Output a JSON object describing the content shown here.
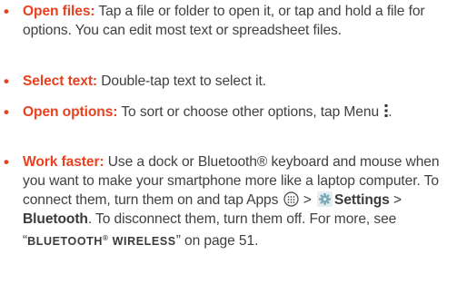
{
  "bullet_char": "•",
  "items": [
    {
      "lead": "Open files:",
      "text": " Tap a file or folder to open it, or tap and hold a file for options. You can edit most text or spreadsheet files."
    },
    {
      "lead": "Select text:",
      "text": " Double-tap text to select it."
    },
    {
      "lead": "Open options:",
      "text": " To sort or choose other options, tap Menu "
    },
    {
      "lead": "Work faster:",
      "text_a": " Use a dock or Bluetooth® keyboard and mouse when you want to make your smartphone more like a laptop computer. To connect them, turn them on and tap Apps ",
      "sep1": " > ",
      "settings_label": "Settings",
      "sep2": " > ",
      "bluetooth_label": "Bluetooth",
      "text_b": ". To disconnect them, turn them off. For more, see “",
      "xref_main": "BLUETOOTH",
      "xref_sup": "®",
      "xref_tail": " WIRELESS",
      "text_c": "” on page 51."
    }
  ],
  "icons": {
    "menu": "menu-icon",
    "apps": "apps-icon",
    "settings": "settings-gear-icon"
  },
  "colors": {
    "accent": "#e8411f",
    "text": "#404040",
    "settings_icon": "#7aa6b8"
  }
}
